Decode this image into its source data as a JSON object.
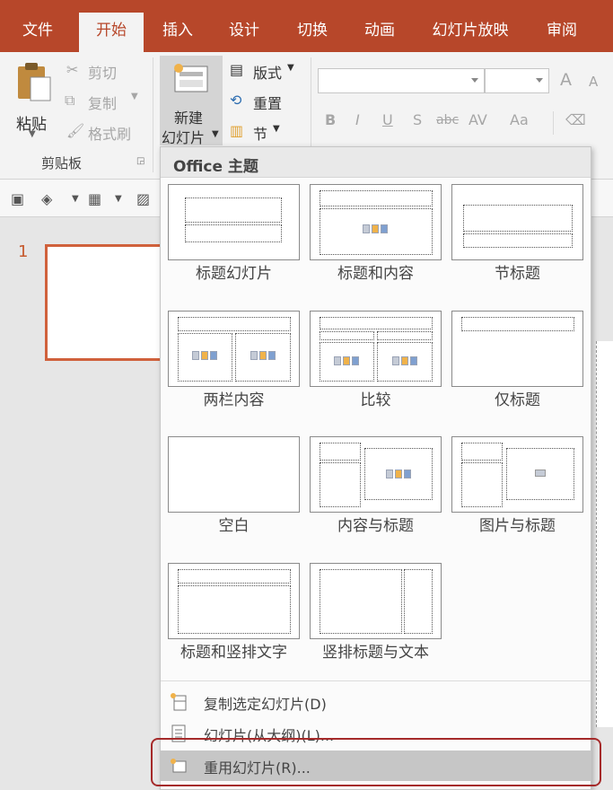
{
  "menu": {
    "tabs": [
      "文件",
      "开始",
      "插入",
      "设计",
      "切换",
      "动画",
      "幻灯片放映",
      "审阅"
    ],
    "active_tab": "开始"
  },
  "ribbon": {
    "clipboard": {
      "paste": "粘贴",
      "cut": "剪切",
      "copy": "复制",
      "format_painter": "格式刷",
      "group_label": "剪贴板"
    },
    "slides": {
      "new_slide_line1": "新建",
      "new_slide_line2": "幻灯片",
      "layout": "版式",
      "reset": "重置",
      "section": "节"
    },
    "font": {
      "font_name": "",
      "font_size": "",
      "grow": "A",
      "shrink": "A",
      "bold": "B",
      "italic": "I",
      "underline": "U",
      "shadow": "S",
      "strike": "abc",
      "spacing": "AV",
      "case": "Aa"
    }
  },
  "workspace": {
    "slide_number": "1"
  },
  "gallery": {
    "header": "Office 主题",
    "layouts": [
      "标题幻灯片",
      "标题和内容",
      "节标题",
      "两栏内容",
      "比较",
      "仅标题",
      "空白",
      "内容与标题",
      "图片与标题",
      "标题和竖排文字",
      "竖排标题与文本"
    ],
    "actions": {
      "duplicate": "复制选定幻灯片(D)",
      "from_outline": "幻灯片(从大纲)(L)...",
      "reuse": "重用幻灯片(R)..."
    }
  },
  "colors": {
    "brand": "#b7472a",
    "accent": "#d0613c",
    "highlight_outline": "#a52a2a"
  }
}
